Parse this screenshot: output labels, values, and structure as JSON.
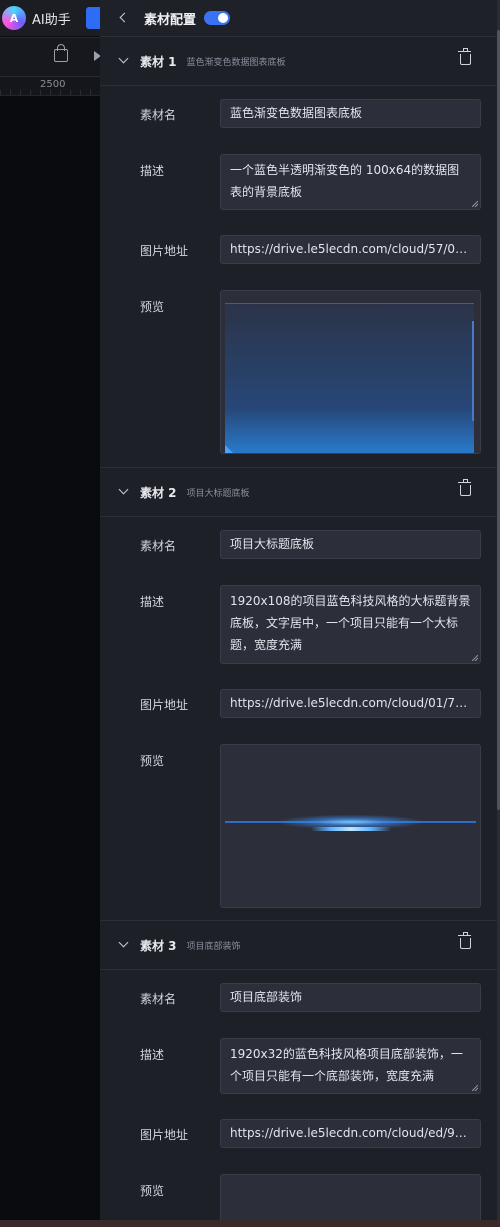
{
  "app": {
    "assistant_label": "AI助手",
    "ruler_value": "2500"
  },
  "panel": {
    "title": "素材配置",
    "toggle_on": true
  },
  "labels": {
    "name": "素材名",
    "desc": "描述",
    "url": "图片地址",
    "preview": "预览"
  },
  "materials": [
    {
      "index_label": "素材 1",
      "subtitle": "蓝色渐变色数据图表底板",
      "name": "蓝色渐变色数据图表底板",
      "description": "一个蓝色半透明渐变色的 100x64的数据图表的背景底板",
      "url": "https://drive.le5lecdn.com/cloud/57/0a/0..."
    },
    {
      "index_label": "素材 2",
      "subtitle": "项目大标题底板",
      "name": "项目大标题底板",
      "description": "1920x108的项目蓝色科技风格的大标题背景底板，文字居中，一个项目只能有一个大标题，宽度充满",
      "url": "https://drive.le5lecdn.com/cloud/01/7f/b1..."
    },
    {
      "index_label": "素材 3",
      "subtitle": "项目底部装饰",
      "name": "项目底部装饰",
      "description": "1920x32的蓝色科技风格项目底部装饰，一个项目只能有一个底部装饰，宽度充满",
      "url": "https://drive.le5lecdn.com/cloud/ed/96/6..."
    }
  ],
  "colors": {
    "accent": "#3b72f5",
    "panel_bg": "#1e2028",
    "field_bg": "#2c2f3a"
  }
}
